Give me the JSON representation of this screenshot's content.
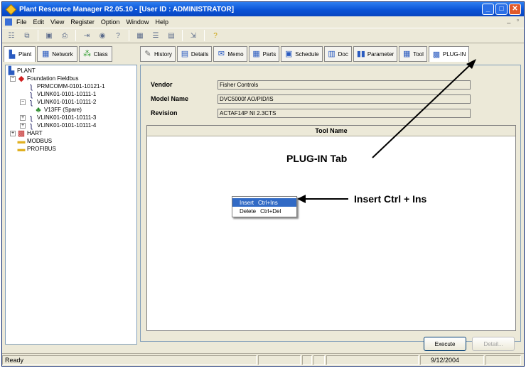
{
  "window": {
    "title": "Plant Resource Manager R2.05.10 - [User ID : ADMINISTRATOR]"
  },
  "menu": [
    "File",
    "Edit",
    "View",
    "Register",
    "Option",
    "Window",
    "Help"
  ],
  "left_tabs": [
    {
      "label": "Plant"
    },
    {
      "label": "Network"
    },
    {
      "label": "Class"
    }
  ],
  "tree": {
    "root": "PLANT",
    "items": [
      {
        "label": "Foundation Fieldbus"
      },
      {
        "label": "PRMCOMM-0101-10121-1"
      },
      {
        "label": "VLINK01-0101-10111-1"
      },
      {
        "label": "VLINK01-0101-10111-2"
      },
      {
        "label": "V13FF (Spare)"
      },
      {
        "label": "VLINK01-0101-10111-3"
      },
      {
        "label": "VLINK01-0101-10111-4"
      },
      {
        "label": "HART"
      },
      {
        "label": "MODBUS"
      },
      {
        "label": "PROFIBUS"
      }
    ]
  },
  "right_tabs": [
    {
      "label": "History"
    },
    {
      "label": "Details"
    },
    {
      "label": "Memo"
    },
    {
      "label": "Parts"
    },
    {
      "label": "Schedule"
    },
    {
      "label": "Doc"
    },
    {
      "label": "Parameter"
    },
    {
      "label": "Tool"
    },
    {
      "label": "PLUG-IN"
    }
  ],
  "fields": [
    {
      "label": "Vendor",
      "value": "Fisher Controls"
    },
    {
      "label": "Model Name",
      "value": "DVC5000f AO/PID/IS"
    },
    {
      "label": "Revision",
      "value": "ACTAF14P NI 2.3CTS"
    }
  ],
  "tool_table": {
    "header": "Tool Name"
  },
  "context_menu": [
    {
      "label": "Insert",
      "shortcut": "Ctrl+Ins"
    },
    {
      "label": "Delete",
      "shortcut": "Ctrl+Del"
    }
  ],
  "buttons": {
    "execute": "Execute",
    "detail": "Detail..."
  },
  "status": {
    "text": "Ready",
    "date": "9/12/2004"
  },
  "callouts": {
    "plugin_tab": "PLUG-IN Tab",
    "insert": "Insert Ctrl + Ins"
  }
}
